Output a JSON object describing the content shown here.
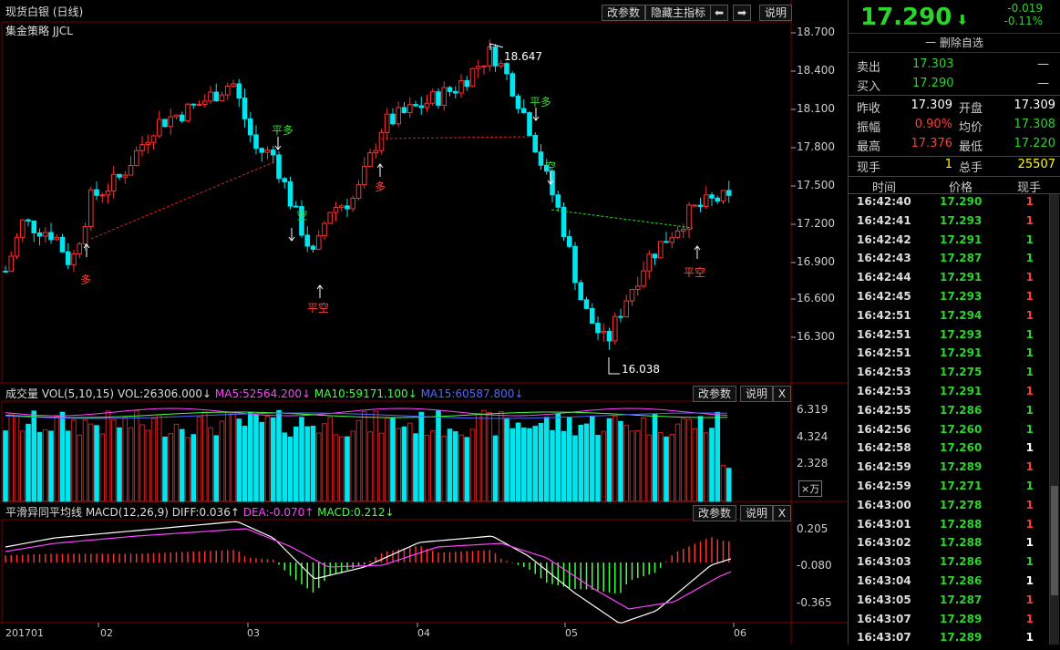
{
  "header": {
    "title": "现货白银 (日线)",
    "btn_params": "改参数",
    "btn_hide_indicator": "隐藏主指标",
    "btn_left": "⬅",
    "btn_right": "➡",
    "btn_help": "说明",
    "strategy": "集金策略 JJCL"
  },
  "main_chart": {
    "y_ticks": [
      "18.700",
      "18.400",
      "18.100",
      "17.800",
      "17.500",
      "17.200",
      "16.900",
      "16.600",
      "16.300"
    ],
    "high_label": "18.647",
    "low_label": "16.038",
    "signals": [
      {
        "text": "平多",
        "color": "#33dd33"
      },
      {
        "text": "空",
        "color": "#33dd33"
      },
      {
        "text": "平空",
        "color": "#ff4040"
      },
      {
        "text": "多",
        "color": "#ff4040"
      },
      {
        "text": "平多",
        "color": "#33dd33"
      },
      {
        "text": "空",
        "color": "#33dd33"
      },
      {
        "text": "平空",
        "color": "#ff4040"
      },
      {
        "text": "多",
        "color": "#ff4040"
      }
    ]
  },
  "volume_panel": {
    "title": "成交量 VOL(5,10,15)",
    "vol": "VOL:26306.000↓",
    "ma5": "MA5:52564.200↓",
    "ma10": "MA10:59171.100↓",
    "ma15": "MA15:60587.800↓",
    "btn_params": "改参数",
    "btn_help": "说明",
    "btn_close": "X",
    "y_ticks": [
      "6.319",
      "4.324",
      "2.328"
    ],
    "unit": "×万"
  },
  "macd_panel": {
    "title": "平滑异同平均线 MACD(12,26,9)",
    "diff": "DIFF:0.036↑",
    "dea": "DEA:-0.070↑",
    "macd": "MACD:0.212↓",
    "btn_params": "改参数",
    "btn_help": "说明",
    "btn_close": "X",
    "y_ticks": [
      "0.205",
      "-0.080",
      "-0.365"
    ]
  },
  "x_axis": [
    "201701",
    "02",
    "03",
    "04",
    "05",
    "06"
  ],
  "quote": {
    "price": "17.290",
    "change": "-0.019",
    "change_pct": "-0.11%",
    "delete_label": "一 删除自选",
    "ask_label": "卖出",
    "ask": "17.303",
    "ask_vol": "—",
    "bid_label": "买入",
    "bid": "17.290",
    "bid_vol": "—",
    "prev_close_label": "昨收",
    "prev_close": "17.309",
    "open_label": "开盘",
    "open": "17.309",
    "amp_label": "振幅",
    "amp": "0.90%",
    "avg_label": "均价",
    "avg": "17.308",
    "high_label": "最高",
    "high": "17.376",
    "low_label": "最低",
    "low": "17.220",
    "cur_vol_label": "现手",
    "cur_vol": "1",
    "total_vol_label": "总手",
    "total_vol": "25507",
    "colors": {
      "up": "#ff3c3c",
      "down": "#2bd52b",
      "neutral": "#ffffff",
      "yellow": "#ffff00"
    }
  },
  "ticks_header": {
    "time": "时间",
    "price": "价格",
    "vol": "现手"
  },
  "ticks": [
    {
      "time": "16:42:40",
      "price": "17.290",
      "vol": "1",
      "dir": "up"
    },
    {
      "time": "16:42:41",
      "price": "17.293",
      "vol": "1",
      "dir": "up"
    },
    {
      "time": "16:42:42",
      "price": "17.291",
      "vol": "1",
      "dir": "down"
    },
    {
      "time": "16:42:43",
      "price": "17.287",
      "vol": "1",
      "dir": "down"
    },
    {
      "time": "16:42:44",
      "price": "17.291",
      "vol": "1",
      "dir": "up"
    },
    {
      "time": "16:42:45",
      "price": "17.293",
      "vol": "1",
      "dir": "up"
    },
    {
      "time": "16:42:51",
      "price": "17.294",
      "vol": "1",
      "dir": "up"
    },
    {
      "time": "16:42:51",
      "price": "17.293",
      "vol": "1",
      "dir": "down"
    },
    {
      "time": "16:42:51",
      "price": "17.291",
      "vol": "1",
      "dir": "down"
    },
    {
      "time": "16:42:53",
      "price": "17.275",
      "vol": "1",
      "dir": "down"
    },
    {
      "time": "16:42:53",
      "price": "17.291",
      "vol": "1",
      "dir": "up"
    },
    {
      "time": "16:42:55",
      "price": "17.286",
      "vol": "1",
      "dir": "down"
    },
    {
      "time": "16:42:56",
      "price": "17.260",
      "vol": "1",
      "dir": "down"
    },
    {
      "time": "16:42:58",
      "price": "17.260",
      "vol": "1",
      "dir": "neutral"
    },
    {
      "time": "16:42:59",
      "price": "17.289",
      "vol": "1",
      "dir": "up"
    },
    {
      "time": "16:42:59",
      "price": "17.271",
      "vol": "1",
      "dir": "down"
    },
    {
      "time": "16:43:00",
      "price": "17.278",
      "vol": "1",
      "dir": "up"
    },
    {
      "time": "16:43:01",
      "price": "17.288",
      "vol": "1",
      "dir": "up"
    },
    {
      "time": "16:43:02",
      "price": "17.288",
      "vol": "1",
      "dir": "neutral"
    },
    {
      "time": "16:43:03",
      "price": "17.286",
      "vol": "1",
      "dir": "down"
    },
    {
      "time": "16:43:04",
      "price": "17.286",
      "vol": "1",
      "dir": "neutral"
    },
    {
      "time": "16:43:05",
      "price": "17.287",
      "vol": "1",
      "dir": "up"
    },
    {
      "time": "16:43:07",
      "price": "17.289",
      "vol": "1",
      "dir": "up"
    },
    {
      "time": "16:43:07",
      "price": "17.289",
      "vol": "1",
      "dir": "neutral"
    }
  ]
}
